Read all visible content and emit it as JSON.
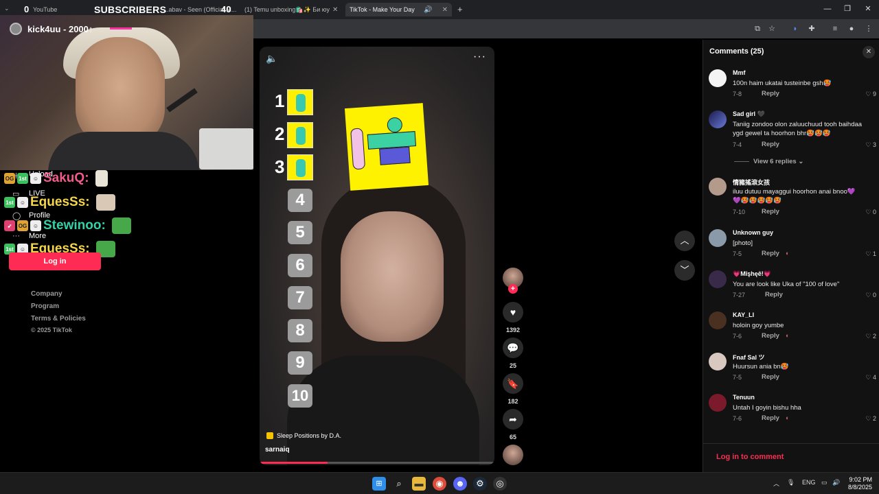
{
  "browser": {
    "tabs": [
      {
        "label": "YouTube"
      },
      {
        "label": "...abav - Seen (Official M..."
      },
      {
        "label": "(1) Temu unboxing🛍️✨ Би юу"
      },
      {
        "label": "TikTok - Make Your Day"
      }
    ],
    "close_glyph": "✕",
    "new_tab": "+"
  },
  "overlay": {
    "subs_count": "0",
    "subs_label": "SUBSCRIBERS",
    "subs_goal": "40",
    "streamer": "kick4uu - 2000↑",
    "chat": [
      {
        "name": "SakuQ:"
      },
      {
        "name": "EquesSs:"
      },
      {
        "name": "Stewinoo:"
      },
      {
        "name": "EquesSs:"
      }
    ],
    "badge_og": "OG",
    "badge_1st": "1st"
  },
  "sidebar": {
    "items": [
      {
        "label": "Upload"
      },
      {
        "label": "LIVE"
      },
      {
        "label": "Profile"
      },
      {
        "label": "More"
      }
    ],
    "login_label": "Log in",
    "footer": [
      "Company",
      "Program",
      "Terms & Policies",
      "© 2025 TikTok"
    ]
  },
  "video": {
    "ranks_top": [
      "1",
      "2",
      "3"
    ],
    "ranks": [
      "4",
      "5",
      "6",
      "7",
      "8",
      "9",
      "10"
    ],
    "music": "Sleep Positions by D.A.",
    "author": "sarnaiq",
    "progress": 0.29
  },
  "actions": {
    "likes": "1392",
    "comments": "25",
    "saves": "182",
    "shares": "65"
  },
  "comments": {
    "title": "Comments (25)",
    "reply_label": "Reply",
    "view_replies": "View 6 replies",
    "login_prompt": "Log in to comment",
    "items": [
      {
        "user": "Mmf",
        "text": "100n haim ukatai tusteinbe gsh🥵",
        "date": "7-8",
        "likes": "9"
      },
      {
        "user": "Sad girl 🖤",
        "text": "Taniig zondoo olon zaluuchuud tooh baihdaa ygd gewel ta hoorhon bhr🥵🥵🥵",
        "date": "7-4",
        "likes": "3"
      },
      {
        "user": "情豬搖滾女孩",
        "text": "iluu dutuu mayaggui hoorhon anai bnoo💜💜🥵🥵🥵🥵🥵",
        "date": "7-10",
        "likes": "0"
      },
      {
        "user": "Unknown guy",
        "text": "[photo]",
        "date": "7-5",
        "likes": "1"
      },
      {
        "user": "💗Mîşhęê!💗",
        "text": "You are look like Uka of \"100 of love\"",
        "date": "7-27",
        "likes": "0"
      },
      {
        "user": "KAY_LI",
        "text": "holoin goy yumbe",
        "date": "7-6",
        "likes": "2"
      },
      {
        "user": "Fnaf Sal ツ",
        "text": "Huursun ania bn🥵",
        "date": "7-5",
        "likes": "4"
      },
      {
        "user": "Tenuun",
        "text": "Untah I goyin bishu hha",
        "date": "7-6",
        "likes": "2"
      }
    ]
  },
  "taskbar": {
    "lang": "ENG",
    "time": "9:02 PM",
    "date": "8/8/2025"
  },
  "colors": {
    "accent": "#fe2c55",
    "panel": "#121212"
  }
}
